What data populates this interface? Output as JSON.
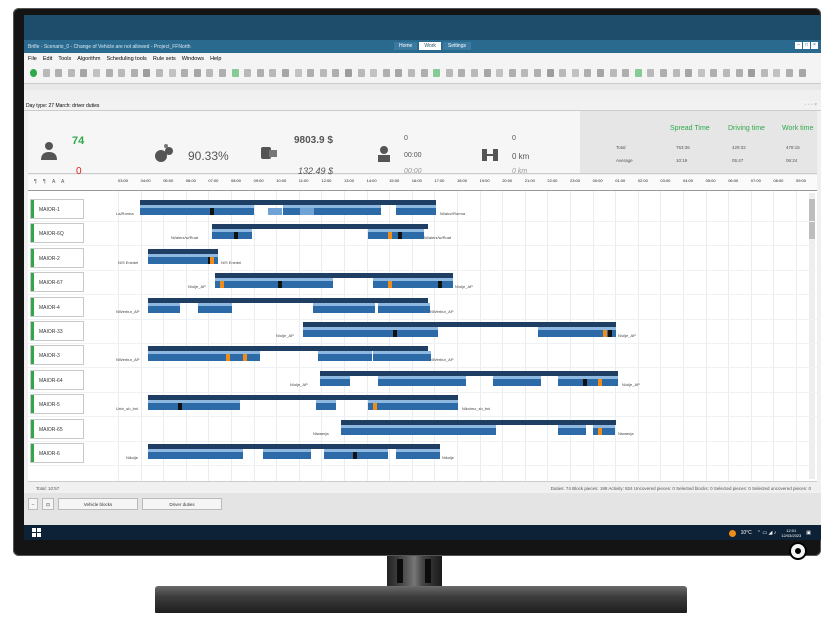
{
  "window": {
    "title": "Brifle - Scenario_0 - Change of Vehicle are not allowed - Project_FFNorth",
    "modes": [
      "Home",
      "Work",
      "Settings"
    ],
    "active_mode": "Work"
  },
  "menu": [
    "File",
    "Edit",
    "Tools",
    "Algorithm",
    "Scheduling tools",
    "Rule sets",
    "Windows",
    "Help"
  ],
  "tab": {
    "label": "Day type: 27 March: driver duties"
  },
  "summary": {
    "duties_ok": "74",
    "duties_bad": "0",
    "efficiency": "90.33%",
    "cost": "9803.9 $",
    "cost_avg": "132.49 $",
    "unassigned_count": "0",
    "unassigned_time": "00:00",
    "unassigned_time_avg": "00:00",
    "deadhead_count": "0",
    "deadhead_km": "0 km",
    "deadhead_km_avg": "0 km",
    "right_headers": [
      "Spread Time",
      "Driving time",
      "Work time"
    ],
    "row_labels": [
      "Total",
      "Average"
    ],
    "total_values": [
      "763:36",
      "429:32",
      "478:15"
    ],
    "average_values": [
      "10:19",
      "05:47",
      "06:24"
    ]
  },
  "ruler": {
    "controls": [
      "¶",
      "¶",
      "A",
      "A"
    ],
    "ticks": [
      "03:00",
      "04:00",
      "05:00",
      "06:00",
      "07:00",
      "08:00",
      "09:00",
      "10:00",
      "11:00",
      "12:00",
      "13:00",
      "14:00",
      "15:00",
      "16:00",
      "17:00",
      "18:00",
      "19:00",
      "20:00",
      "21:00",
      "22:00",
      "23:00",
      "00:00",
      "01:00",
      "02:00",
      "03:00",
      "04:00",
      "05:00",
      "06:00",
      "07:00",
      "08:00",
      "09:00"
    ]
  },
  "rows": [
    {
      "name": "MAIOR-1",
      "start_place": "La/Rorma",
      "end_place": "Ni/alcz/Rorma"
    },
    {
      "name": "MAIOR-6Q",
      "start_place": "Ni/alerz/w/Ruat",
      "end_place": "Ni/alerz/w/Ruat"
    },
    {
      "name": "MAIOR-2",
      "start_place": "N/S Enedei",
      "end_place": "N/S Enedei"
    },
    {
      "name": "MAIOR-67",
      "start_place": "N/olje_AP",
      "end_place": "N/olje_AP"
    },
    {
      "name": "MAIOR-4",
      "start_place": "NWerbur_AP",
      "end_place": "NWerbur_AP"
    },
    {
      "name": "MAIOR-33",
      "start_place": "N/olje_AP",
      "end_place": "N/olje_AP"
    },
    {
      "name": "MAIOR-3",
      "start_place": "NWerbur_AP",
      "end_place": "NWerbur_AP"
    },
    {
      "name": "MAIOR-64",
      "start_place": "N/olje_AP",
      "end_place": "N/olje_AP"
    },
    {
      "name": "MAIOR-5",
      "start_place": "Univ_sh_bnl",
      "end_place": "Nikolmz_sh_bnl"
    },
    {
      "name": "MAIOR-65",
      "start_place": "Niwaerja",
      "end_place": "Niwaerja"
    },
    {
      "name": "MAIOR-6",
      "start_place": "Nikolje",
      "end_place": "Nikolje"
    }
  ],
  "status": {
    "left": "Total: 10:57",
    "right": "Duties: 74   Block pieces: 198   Activity: 824   Uncovered pieces: 0   Selected blocks: 0   Selected pieces: 0   Selected uncovered pieces: 0"
  },
  "bottom_buttons": [
    "Vehicle blocks",
    "Driver duties"
  ],
  "tray": {
    "temp": "10°C",
    "time": "12:01",
    "date": "12/03/2023"
  }
}
